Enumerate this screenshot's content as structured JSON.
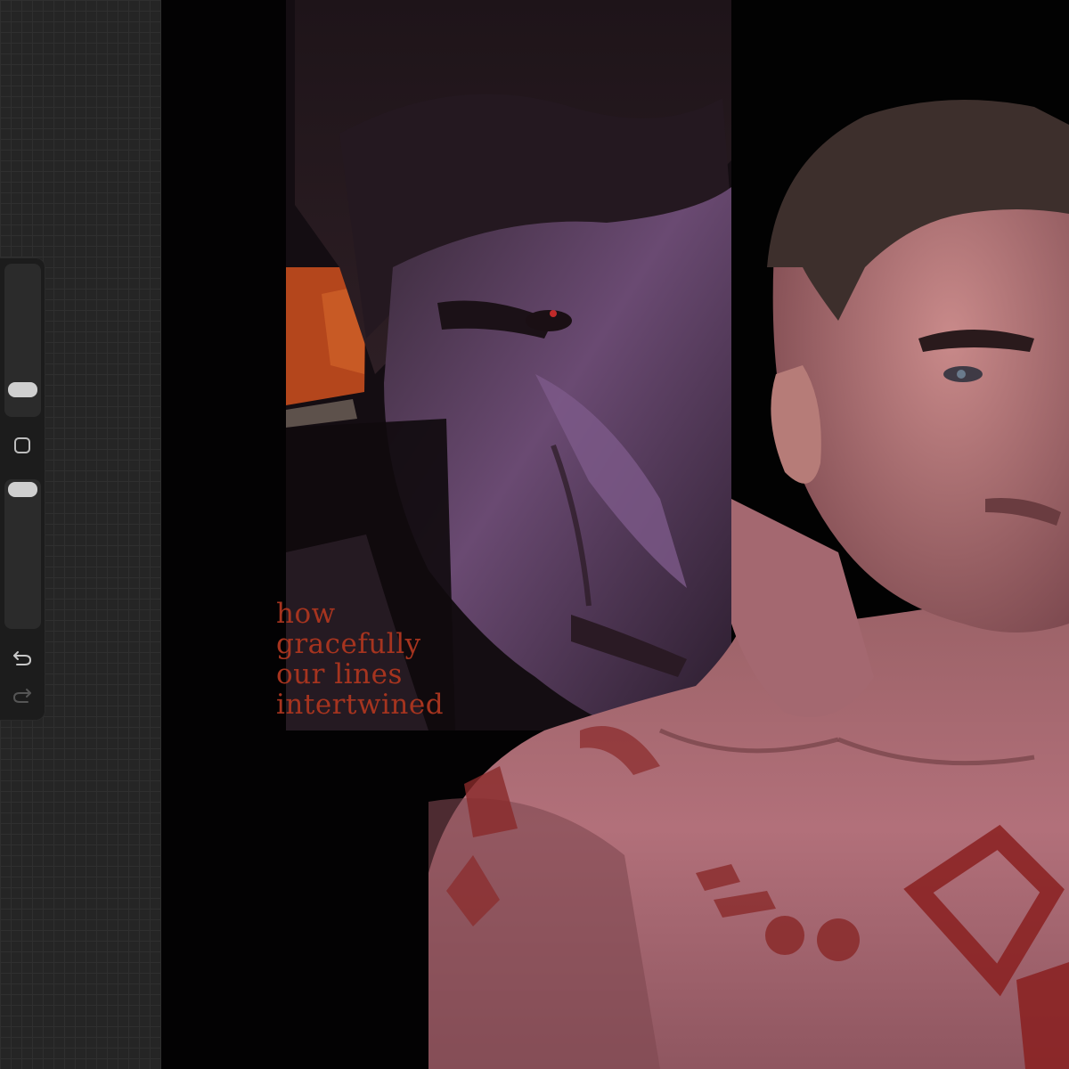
{
  "artwork": {
    "caption_lines": [
      "how",
      "gracefully",
      "our lines",
      "intertwined"
    ],
    "caption_color": "#a6341f"
  },
  "sidebar": {
    "brush_size_slider": {
      "value": 0.1
    },
    "opacity_slider": {
      "value": 0.9
    },
    "modify_button_icon": "square-icon",
    "undo_icon": "undo-icon",
    "redo_icon": "redo-icon"
  },
  "colors": {
    "workspace": "#252525",
    "canvas": "#020202",
    "sidebar": "#1c1c1c"
  }
}
